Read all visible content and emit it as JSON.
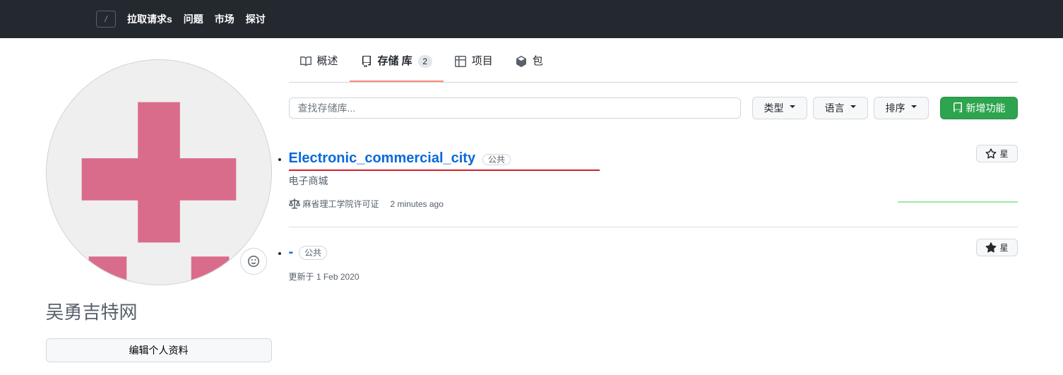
{
  "header": {
    "nav": [
      {
        "key": "pulls",
        "label": "拉取请求s"
      },
      {
        "key": "issues",
        "label": "问题"
      },
      {
        "key": "marketplace",
        "label": "市场"
      },
      {
        "key": "explore",
        "label": "探讨"
      }
    ],
    "slash": "/"
  },
  "profile": {
    "username": "吴勇吉特网",
    "edit_label": "编辑个人资料"
  },
  "tabs": {
    "overview": "概述",
    "repos": "存储 库",
    "repos_count": "2",
    "projects": "项目",
    "packages": "包"
  },
  "filters": {
    "search_placeholder": "查找存储库...",
    "type": "类型",
    "language": "语言",
    "sort": "排序",
    "new": "新增功能"
  },
  "repos": [
    {
      "name": "Electronic_commercial_city",
      "visibility": "公共",
      "description": "电子商城",
      "license": "麻省理工学院许可证",
      "updated": "2 minutes ago",
      "star_label": "星",
      "highlighted": true,
      "has_license": true,
      "has_description": true,
      "show_activity": true
    },
    {
      "name": "-",
      "visibility": "公共",
      "description": "",
      "license": "",
      "updated": "更新于 1 Feb 2020",
      "star_label": "星",
      "highlighted": false,
      "has_license": false,
      "has_description": false,
      "show_activity": false
    }
  ]
}
